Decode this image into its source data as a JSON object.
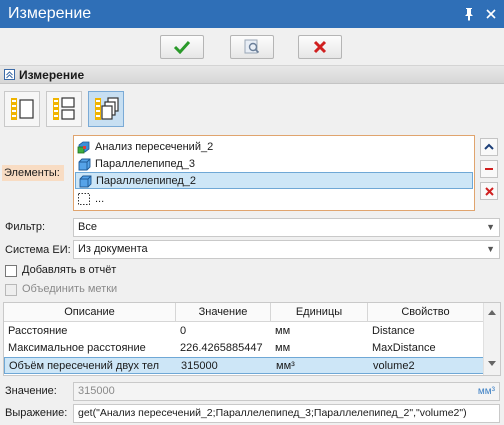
{
  "window": {
    "title": "Измерение"
  },
  "section": {
    "title": "Измерение"
  },
  "labels": {
    "elements": "Элементы:",
    "filter": "Фильтр:",
    "unit_system": "Система ЕИ:",
    "add_to_report": "Добавлять в отчёт",
    "merge_labels": "Объединить метки",
    "value": "Значение:",
    "expression": "Выражение:"
  },
  "elements": [
    {
      "name": "Анализ пересечений_2",
      "icon": "intersection-analysis-icon",
      "selected": false
    },
    {
      "name": "Параллелепипед_3",
      "icon": "box-icon",
      "selected": false
    },
    {
      "name": "Параллелепипед_2",
      "icon": "box-icon",
      "selected": true
    },
    {
      "name": "...",
      "icon": "empty-slot-icon",
      "selected": false
    }
  ],
  "filter": {
    "value": "Все"
  },
  "unit_system": {
    "value": "Из документа"
  },
  "add_to_report": false,
  "merge_labels": false,
  "table": {
    "columns": [
      "Описание",
      "Значение",
      "Единицы",
      "Свойство"
    ],
    "rows": [
      {
        "description": "Расстояние",
        "value": "0",
        "units": "мм",
        "property": "Distance",
        "selected": false
      },
      {
        "description": "Максимальное расстояние",
        "value": "226.4265885447",
        "units": "мм",
        "property": "MaxDistance",
        "selected": false
      },
      {
        "description": "Объём пересечений двух тел",
        "value": "315000",
        "units": "мм³",
        "property": "volume2",
        "selected": true
      }
    ]
  },
  "value_field": {
    "value": "315000",
    "unit": "мм³"
  },
  "expression_field": {
    "value": "get(\"Анализ пересечений_2;Параллелепипед_3;Параллелепипед_2\",\"volume2\")"
  },
  "colors": {
    "titlebar": "#2f6fb7",
    "ok": "#2a9a2a",
    "cancel": "#d02020",
    "selection": "#cde6f7",
    "required_field": "#f8dcc3"
  }
}
